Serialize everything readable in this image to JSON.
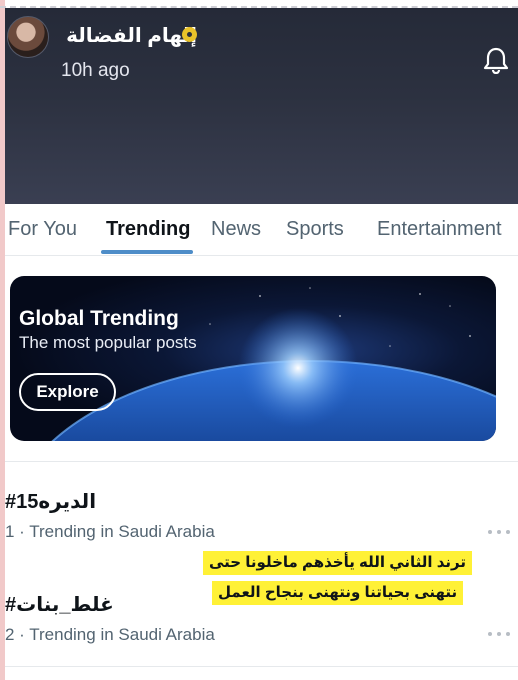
{
  "header": {
    "username": "إلهام الفضالة",
    "timestamp": "10h ago",
    "icons": {
      "verified": "verified-badge-icon",
      "bell": "bell-icon"
    }
  },
  "tabs": [
    {
      "label": "For You",
      "active": false
    },
    {
      "label": "Trending",
      "active": true
    },
    {
      "label": "News",
      "active": false
    },
    {
      "label": "Sports",
      "active": false
    },
    {
      "label": "Entertainment",
      "active": false
    }
  ],
  "banner": {
    "title": "Global Trending",
    "subtitle": "The most popular posts",
    "button_label": "Explore"
  },
  "trends": [
    {
      "tag": "#الديره15",
      "meta": "1 · Trending in Saudi Arabia"
    },
    {
      "tag": "#غلط_بنات",
      "meta": "2 · Trending in Saudi Arabia"
    }
  ],
  "caption": {
    "line1": "ترند الثاني  الله يأخذهم ماخلونا حتى",
    "line2": "نتهنى بحياتنا ونتهنى  بنجاح العمل"
  },
  "colors": {
    "header_bg": "#2c3140",
    "accent_underline": "#4e8dc8",
    "caption_highlight": "#fff136",
    "muted_text": "#536471"
  }
}
